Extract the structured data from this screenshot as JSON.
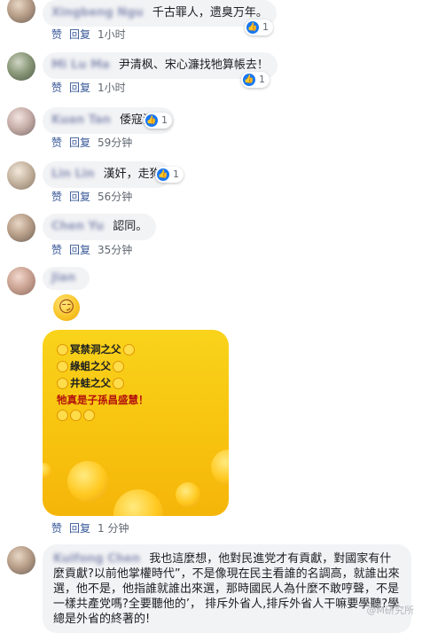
{
  "actions": {
    "like": "赞",
    "reply": "回复"
  },
  "comments": [
    {
      "name": "Xingbeng Ngu",
      "text": "千古罪人，遗臭万年。",
      "reactions": "1",
      "time": "1小时"
    },
    {
      "name": "Mi Lu Ma",
      "text": "尹清枫、宋心濂找牠算帳去！",
      "reactions": "1",
      "time": "1小时"
    },
    {
      "name": "Kuan Tan",
      "text": "倭寇漢奸",
      "reactions": "1",
      "time": "59分钟"
    },
    {
      "name": "Lin Lin",
      "text": "漢奸，走狗",
      "reactions": "1",
      "time": "56分钟"
    },
    {
      "name": "Chen Yu",
      "text": "認同。",
      "time": "35分钟"
    },
    {
      "name": "Jian",
      "time": "1 分钟",
      "image_lines": [
        "冥禁洞之父",
        "綠蛆之父",
        "井蛙之父",
        "牠真是子孫昌盛慧！"
      ]
    },
    {
      "name": "Kuifong Chen",
      "text": "我也這麼想，他對民進党才有貢獻，對國家有什麼貢獻?以前他掌權時代”，不是像現在民主看誰的名調高，就誰出來選，他不是，他指誰就誰出來選，那時國民人為什麼不敢哼聲，不是一樣共產党嗎?全要聽他的’， 排斥外省人,排斥外省人干嘛要學聽?學總是外省的終著的!"
    }
  ],
  "watermark": "@M研究所",
  "colors": {
    "like_blue": "#1877f2",
    "link": "#385898",
    "bubble": "#f2f3f5",
    "image_yellow": "#f7c20e"
  },
  "icons": {
    "like": "thumbs-up-icon",
    "smirk": "smirk-emoji"
  }
}
